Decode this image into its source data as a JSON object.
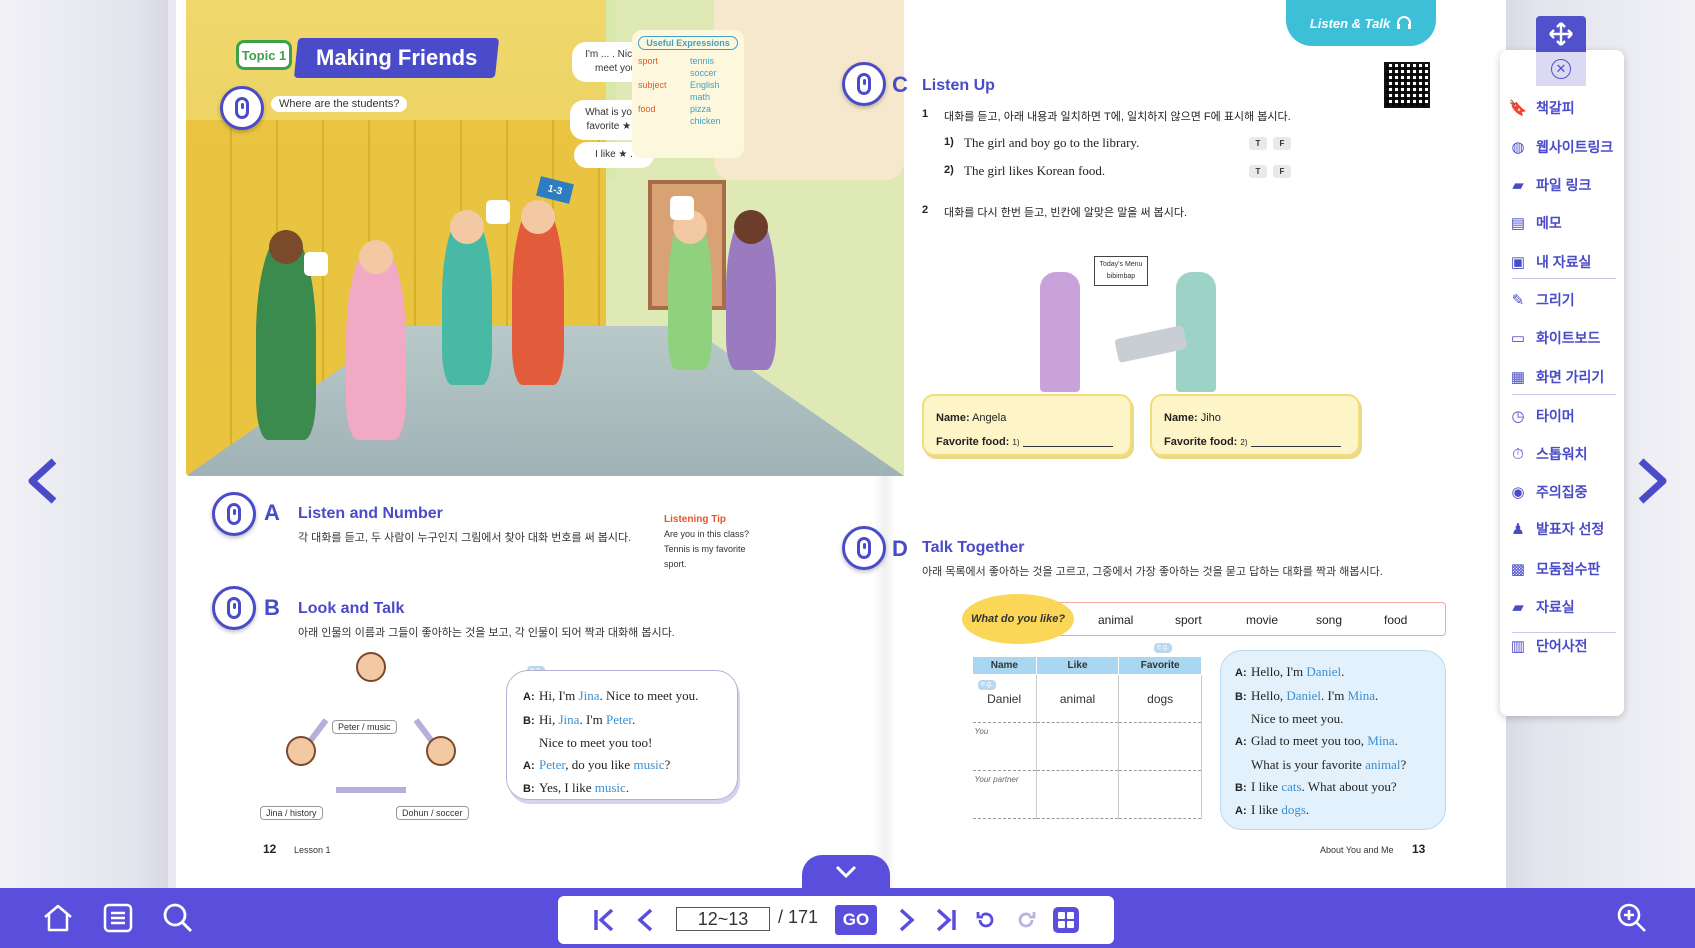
{
  "left_page": {
    "topic_badge": "Topic 1",
    "topic_title": "Making Friends",
    "scene_question": "Where are the students?",
    "bubble_nice": "I'm ... . Nice to meet you.",
    "bubble_favorite": "What is your favorite ★ ?",
    "bubble_ilike": "I like ★ .",
    "useful_title": "Useful Expressions",
    "useful_rows": [
      {
        "k": "sport",
        "v": "tennis"
      },
      {
        "k": "",
        "v": "soccer"
      },
      {
        "k": "subject",
        "v": "English"
      },
      {
        "k": "",
        "v": "math"
      },
      {
        "k": "food",
        "v": "pizza"
      },
      {
        "k": "",
        "v": "chicken"
      }
    ],
    "room_sign": "1-3",
    "section_a": {
      "letter": "A",
      "title": "Listen and Number",
      "desc": "각 대화를 듣고, 두 사람이 누구인지 그림에서 찾아 대화 번호를 써 봅시다."
    },
    "tip": {
      "title": "Listening Tip",
      "lines": [
        "Are you in this class?",
        "Tennis is my favorite",
        "sport."
      ]
    },
    "section_b": {
      "letter": "B",
      "title": "Look and Talk",
      "desc": "아래 인물의 이름과 그들이 좋아하는 것을 보고, 각 인물이 되어 짝과 대화해 봅시다."
    },
    "char_tags": [
      "Peter / music",
      "Jina / history",
      "Dohun / soccer"
    ],
    "eg_label": "e.g.",
    "dialog_b": [
      {
        "sp": "A:",
        "t": "Hi, I'm Jina. Nice to meet you."
      },
      {
        "sp": "B:",
        "t": "Hi, Jina. I'm Peter."
      },
      {
        "sp": "",
        "t": "Nice to meet you too!"
      },
      {
        "sp": "A:",
        "t": "Peter, do you like music?"
      },
      {
        "sp": "B:",
        "t": "Yes, I like music."
      }
    ],
    "page_number": "12",
    "page_label": "Lesson 1"
  },
  "right_page": {
    "corner_tab": "Listen & Talk",
    "section_c": {
      "letter": "C",
      "title": "Listen Up"
    },
    "q1": "대화를 듣고, 아래 내용과 일치하면 T에, 일치하지 않으면 F에 표시해 봅시다.",
    "q1_items": [
      "The girl and boy go to the library.",
      "The girl likes Korean food."
    ],
    "q1_item_numbers": [
      "1)",
      "2)"
    ],
    "tf_labels": [
      "T",
      "F"
    ],
    "q2": "대화를 다시 한번 듣고, 빈칸에 알맞은 말을 써 봅시다.",
    "q_numbers": [
      "1",
      "2"
    ],
    "menu_sign": "Today's Menu bibimbap",
    "card1": {
      "name_label": "Name:",
      "name": "Angela",
      "food_label": "Favorite food:",
      "blank_no": "1)"
    },
    "card2": {
      "name_label": "Name:",
      "name": "Jiho",
      "food_label": "Favorite food:",
      "blank_no": "2)"
    },
    "section_d": {
      "letter": "D",
      "title": "Talk Together",
      "desc": "아래 목록에서 좋아하는 것을 고르고, 그중에서 가장 좋아하는 것을 묻고 답하는 대화를 짝과 해봅시다."
    },
    "what_like": "What do you like?",
    "choices": [
      "animal",
      "sport",
      "movie",
      "song",
      "food"
    ],
    "table_headers": [
      "Name",
      "Like",
      "Favorite"
    ],
    "table_rows": [
      {
        "name": "Daniel",
        "like": "animal",
        "fav": "dogs"
      },
      {
        "name": "You",
        "like": "",
        "fav": ""
      },
      {
        "name": "Your partner",
        "like": "",
        "fav": ""
      }
    ],
    "dialog_d": [
      {
        "sp": "A:",
        "t": "Hello, I'm Daniel."
      },
      {
        "sp": "B:",
        "t": "Hello, Daniel. I'm Mina."
      },
      {
        "sp": "",
        "t": "Nice to meet you."
      },
      {
        "sp": "A:",
        "t": "Glad to meet you too, Mina."
      },
      {
        "sp": "",
        "t": "What is your favorite animal?"
      },
      {
        "sp": "B:",
        "t": "I like cats. What about you?"
      },
      {
        "sp": "A:",
        "t": "I like dogs."
      }
    ],
    "page_number": "13",
    "page_label": "About You and Me"
  },
  "tool_panel": {
    "items": [
      "책갈피",
      "웹사이트링크",
      "파일 링크",
      "메모",
      "내 자료실",
      "그리기",
      "화이트보드",
      "화면 가리기",
      "타이머",
      "스톱워치",
      "주의집중",
      "발표자 선정",
      "모둠점수판",
      "자료실",
      "단어사전"
    ],
    "icons": [
      "bookmark-icon",
      "globe-icon",
      "file-link-icon",
      "memo-icon",
      "briefcase-icon",
      "pencil-icon",
      "whiteboard-icon",
      "screen-cover-icon",
      "timer-icon",
      "stopwatch-icon",
      "attention-icon",
      "presenter-icon",
      "scoreboard-icon",
      "folder-icon",
      "dictionary-icon"
    ]
  },
  "pager": {
    "current": "12~13",
    "total": "/ 171",
    "go_label": "GO"
  },
  "colors": {
    "accent": "#5a4fdc",
    "brand_blue": "#4a4bc8",
    "highlight": "#3b8fd1",
    "tab_cyan": "#3ebfd8"
  }
}
